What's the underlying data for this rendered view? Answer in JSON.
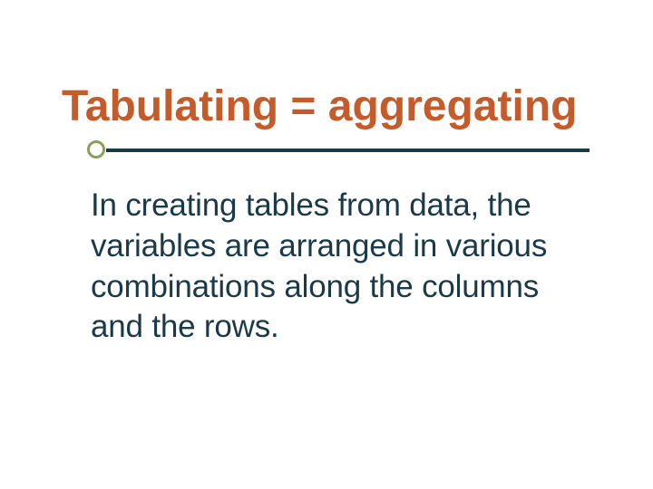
{
  "slide": {
    "title": "Tabulating = aggregating",
    "body": "In creating tables from data, the variables are arranged in various combinations along the columns and the rows."
  }
}
